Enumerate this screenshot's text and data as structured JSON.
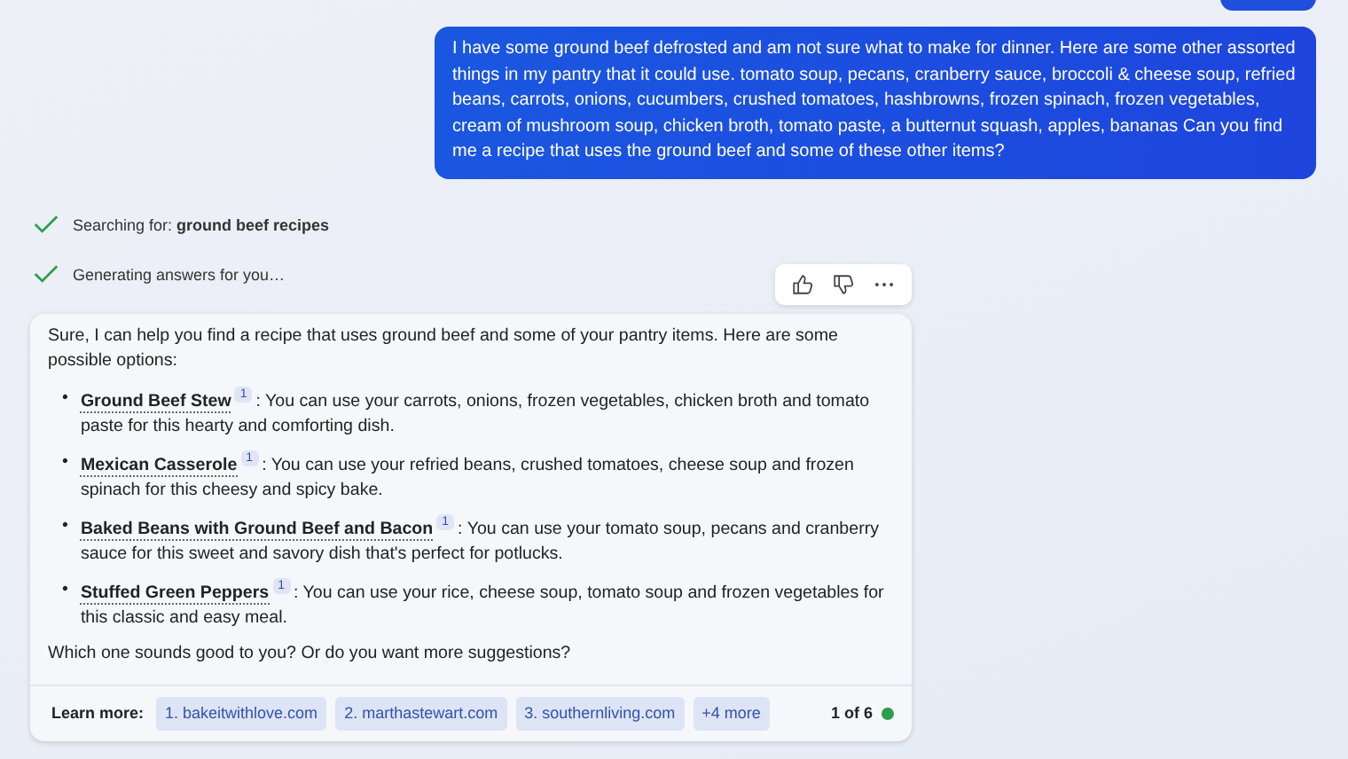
{
  "user_message": {
    "text": "I have some ground beef defrosted and am not sure what to make for dinner. Here are some other assorted things in my pantry that it could use. tomato soup, pecans, cranberry sauce, broccoli & cheese soup, refried beans, carrots, onions, cucumbers, crushed tomatoes, hashbrowns, frozen spinach, frozen vegetables, cream of mushroom soup, chicken broth, tomato paste, a butternut squash, apples, bananas Can you find me a recipe that uses the ground beef and some of these other items?"
  },
  "progress": [
    {
      "text": "Searching for: **ground beef recipes**",
      "done": true
    },
    {
      "text": "Generating answers for you…",
      "done": true
    }
  ],
  "answer": {
    "intro": "Sure, I can help you find a recipe that uses ground beef and some of your pantry items. Here are some possible options:",
    "options": [
      {
        "bullet": "•",
        "title": "Ground Beef Stew",
        "citation": "1",
        "text": ": You can use your carrots, onions, frozen vegetables, chicken broth and tomato paste for this hearty and comforting dish."
      },
      {
        "bullet": "•",
        "title": "Mexican Casserole",
        "citation": "1",
        "text": ": You can use your refried beans, crushed tomatoes, cheese soup and frozen spinach for this cheesy and spicy bake."
      },
      {
        "bullet": "•",
        "title": "Baked Beans with Ground Beef and Bacon",
        "citation": "1",
        "text": ": You can use your tomato soup, pecans and cranberry sauce for this sweet and savory dish that's perfect for potlucks."
      },
      {
        "bullet": "•",
        "title": "Stuffed Green Peppers",
        "citation": "1",
        "text": ": You can use your rice, cheese soup, tomato soup and frozen vegetables for this classic and easy meal."
      }
    ],
    "closing": "Which one sounds good to you? Or do you want more suggestions?",
    "learn_more": {
      "label": "Learn more:",
      "sources": [
        "1. bakeitwithlove.com",
        "2. marthastewart.com",
        "3. southernliving.com"
      ],
      "more": "+4 more"
    },
    "counter": {
      "text": "1 of 6",
      "color": "#2e9e4a"
    }
  }
}
